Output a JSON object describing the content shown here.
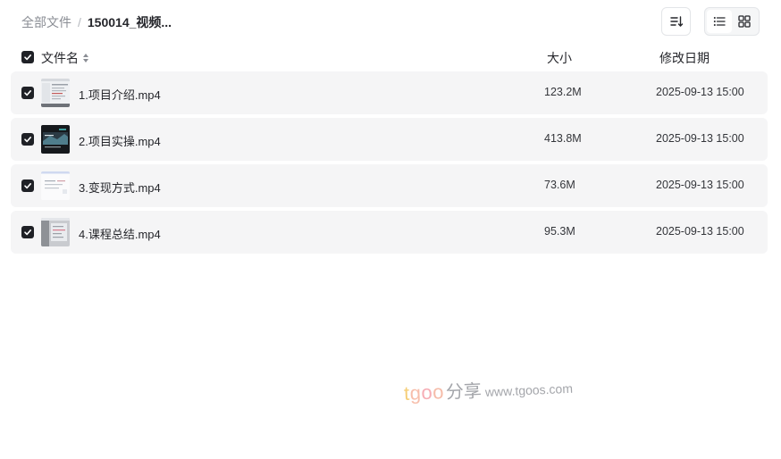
{
  "breadcrumb": {
    "root": "全部文件",
    "separator": "/",
    "current": "150014_视频..."
  },
  "toolbar": {
    "sort_icon": "sort-list-icon",
    "list_view_icon": "list-view-icon",
    "grid_view_icon": "grid-view-icon",
    "active_view": "list"
  },
  "columns": {
    "name": "文件名",
    "size": "大小",
    "date": "修改日期"
  },
  "select_all_checked": true,
  "files": [
    {
      "name": "1.项目介绍.mp4",
      "size": "123.2M",
      "modified": "2025-09-13 15:00",
      "checked": true,
      "thumbnail": "light-screenshot"
    },
    {
      "name": "2.项目实操.mp4",
      "size": "413.8M",
      "modified": "2025-09-13 15:00",
      "checked": true,
      "thumbnail": "dark-screenshot"
    },
    {
      "name": "3.变现方式.mp4",
      "size": "73.6M",
      "modified": "2025-09-13 15:00",
      "checked": true,
      "thumbnail": "white-screenshot"
    },
    {
      "name": "4.课程总结.mp4",
      "size": "95.3M",
      "modified": "2025-09-13 15:00",
      "checked": true,
      "thumbnail": "gray-screenshot"
    }
  ],
  "watermark": {
    "t": "t",
    "g": "g",
    "o1": "o",
    "o2": "o",
    "cn": "分享",
    "url": "www.tgoos.com"
  },
  "colors": {
    "row_background": "#f5f5f6",
    "checkbox": "#1f2126",
    "muted_text": "#8a8d94"
  }
}
